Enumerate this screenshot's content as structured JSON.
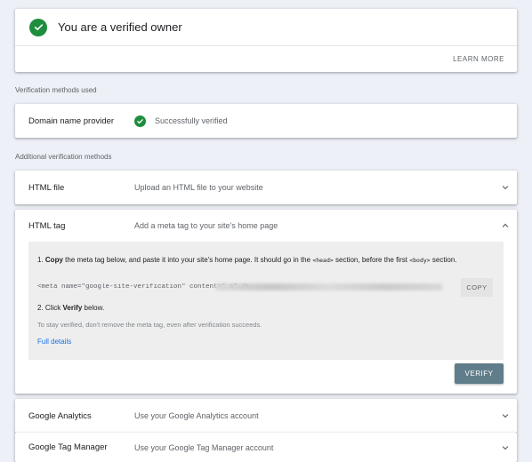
{
  "owner": {
    "title": "You are a verified owner",
    "learn_more": "LEARN MORE"
  },
  "sections": {
    "used": "Verification methods used",
    "additional": "Additional verification methods"
  },
  "domain_provider": {
    "name": "Domain name provider",
    "status": "Successfully verified"
  },
  "html_file": {
    "name": "HTML file",
    "desc": "Upload an HTML file to your website"
  },
  "html_tag": {
    "name": "HTML tag",
    "desc": "Add a meta tag to your site's home page",
    "step1_num": "1.",
    "step1_bold": "Copy",
    "step1_text_a": "the meta tag below, and paste it into your site's home page. It should go in the",
    "step1_code_head": "<head>",
    "step1_text_b": "section, before the first",
    "step1_code_body": "<body>",
    "step1_text_c": "section.",
    "meta_tag": "<meta name=\"google-site-verification\" content=\"                                                                   s\" />",
    "copy": "COPY",
    "step2_num": "2. Click",
    "step2_bold": "Verify",
    "step2_text": "below.",
    "hint": "To stay verified, don't remove the meta tag, even after verification succeeds.",
    "full_details": "Full details",
    "verify": "VERIFY"
  },
  "google_analytics": {
    "name": "Google Analytics",
    "desc": "Use your Google Analytics account"
  },
  "google_tag_manager": {
    "name": "Google Tag Manager",
    "desc": "Use your Google Tag Manager account"
  },
  "colors": {
    "success_green": "#1e8e3e",
    "link_blue": "#1a73e8",
    "verify_button": "#607d8b",
    "page_background": "#eef0f7"
  },
  "icons": {
    "check": "check-circle-icon",
    "chevron_down": "chevron-down-icon",
    "chevron_up": "chevron-up-icon"
  }
}
